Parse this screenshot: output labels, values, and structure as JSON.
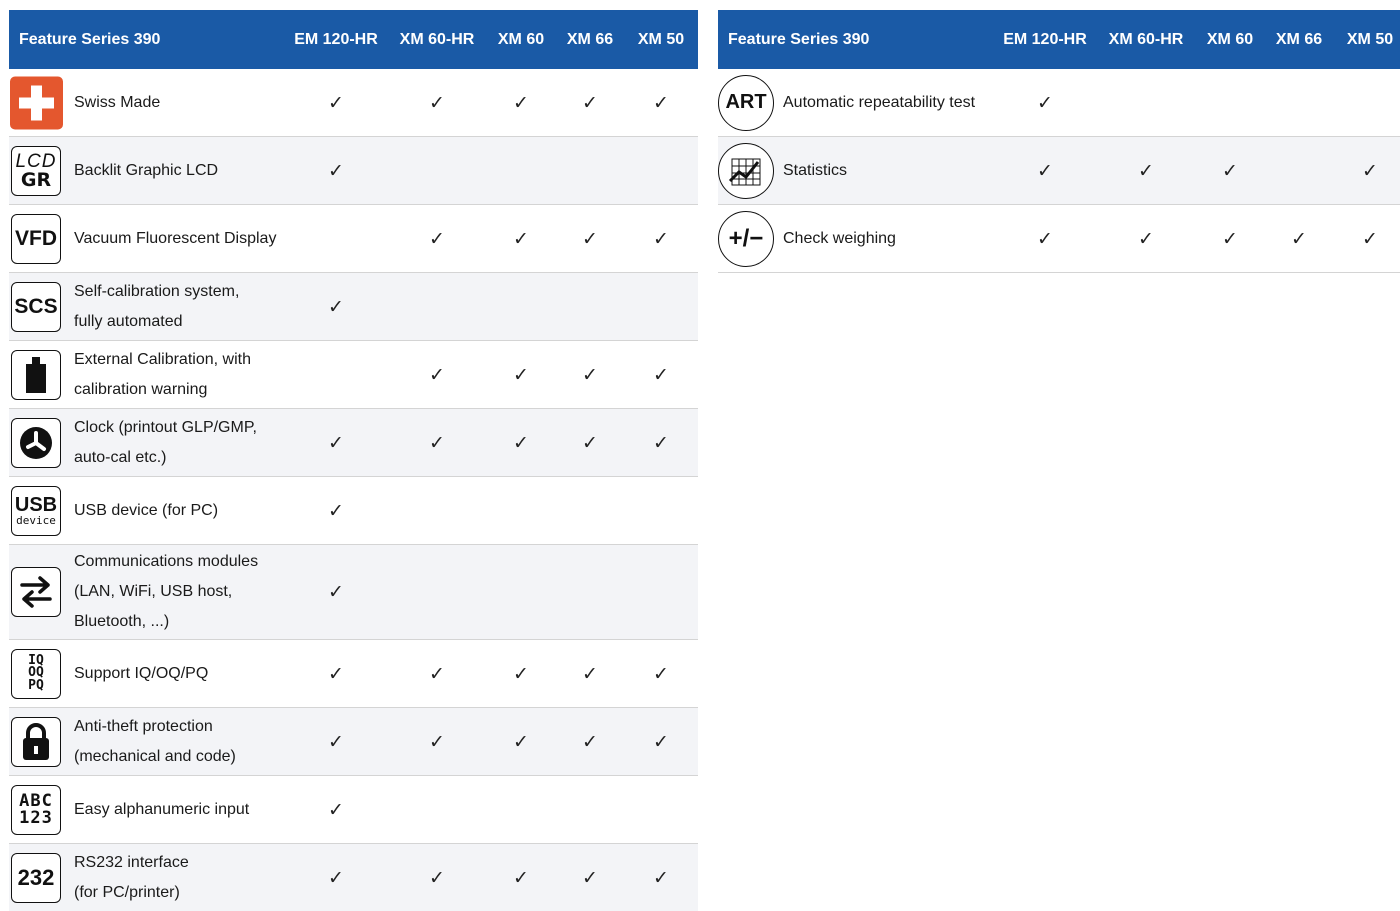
{
  "left_table": {
    "header": {
      "feature": "Feature Series 390",
      "columns": [
        "EM 120-HR",
        "XM 60-HR",
        "XM 60",
        "XM 66",
        "XM 50"
      ]
    },
    "rows": [
      {
        "icon": "swiss-cross-icon",
        "icon_text": "",
        "label_lines": [
          "Swiss Made"
        ],
        "checks": [
          true,
          true,
          true,
          true,
          true
        ]
      },
      {
        "icon": "lcd-gr-icon",
        "icon_text": "LCD GR",
        "label_lines": [
          "Backlit Graphic LCD"
        ],
        "checks": [
          true,
          false,
          false,
          false,
          false
        ]
      },
      {
        "icon": "vfd-icon",
        "icon_text": "VFD",
        "label_lines": [
          "Vacuum Fluorescent Display"
        ],
        "checks": [
          false,
          true,
          true,
          true,
          true
        ]
      },
      {
        "icon": "scs-icon",
        "icon_text": "SCS",
        "label_lines": [
          "Self-calibration system,",
          "fully automated"
        ],
        "checks": [
          true,
          false,
          false,
          false,
          false
        ]
      },
      {
        "icon": "weight-icon",
        "icon_text": "",
        "label_lines": [
          "External Calibration, with",
          "calibration warning"
        ],
        "checks": [
          false,
          true,
          true,
          true,
          true
        ]
      },
      {
        "icon": "clock-icon",
        "icon_text": "",
        "label_lines": [
          "Clock (printout GLP/GMP,",
          "auto-cal etc.)"
        ],
        "checks": [
          true,
          true,
          true,
          true,
          true
        ]
      },
      {
        "icon": "usb-device-icon",
        "icon_text": "USB device",
        "label_lines": [
          "USB device (for PC)"
        ],
        "checks": [
          true,
          false,
          false,
          false,
          false
        ]
      },
      {
        "icon": "exchange-arrows-icon",
        "icon_text": "",
        "label_lines": [
          "Communications modules",
          "(LAN, WiFi, USB host,",
          "Bluetooth, ...)"
        ],
        "checks": [
          true,
          false,
          false,
          false,
          false
        ]
      },
      {
        "icon": "iq-oq-pq-icon",
        "icon_text": "IQ OQ PQ",
        "label_lines": [
          "Support IQ/OQ/PQ"
        ],
        "checks": [
          true,
          true,
          true,
          true,
          true
        ]
      },
      {
        "icon": "padlock-icon",
        "icon_text": "",
        "label_lines": [
          "Anti-theft protection",
          "(mechanical and code)"
        ],
        "checks": [
          true,
          true,
          true,
          true,
          true
        ]
      },
      {
        "icon": "abc-123-icon",
        "icon_text": "ABC 123",
        "label_lines": [
          "Easy alphanumeric input"
        ],
        "checks": [
          true,
          false,
          false,
          false,
          false
        ]
      },
      {
        "icon": "rs232-icon",
        "icon_text": "232",
        "label_lines": [
          "RS232 interface",
          "(for PC/printer)"
        ],
        "checks": [
          true,
          true,
          true,
          true,
          true
        ]
      }
    ]
  },
  "right_table": {
    "header": {
      "feature": "Feature Series 390",
      "columns": [
        "EM 120-HR",
        "XM 60-HR",
        "XM 60",
        "XM 66",
        "XM 50"
      ]
    },
    "rows": [
      {
        "icon": "art-icon",
        "icon_text": "ART",
        "label_lines": [
          "Automatic repeatability test"
        ],
        "checks": [
          true,
          false,
          false,
          false,
          false
        ]
      },
      {
        "icon": "statistics-chart-icon",
        "icon_text": "",
        "label_lines": [
          "Statistics"
        ],
        "checks": [
          true,
          true,
          true,
          false,
          true
        ]
      },
      {
        "icon": "plus-minus-icon",
        "icon_text": "+/−",
        "label_lines": [
          "Check weighing"
        ],
        "checks": [
          true,
          true,
          true,
          true,
          true
        ]
      }
    ]
  },
  "check_glyph": "✓",
  "colors": {
    "header_bg": "#1a5aa6",
    "header_text": "#ffffff",
    "swiss_red": "#e4572e",
    "alt_row": "#f3f4f7"
  }
}
